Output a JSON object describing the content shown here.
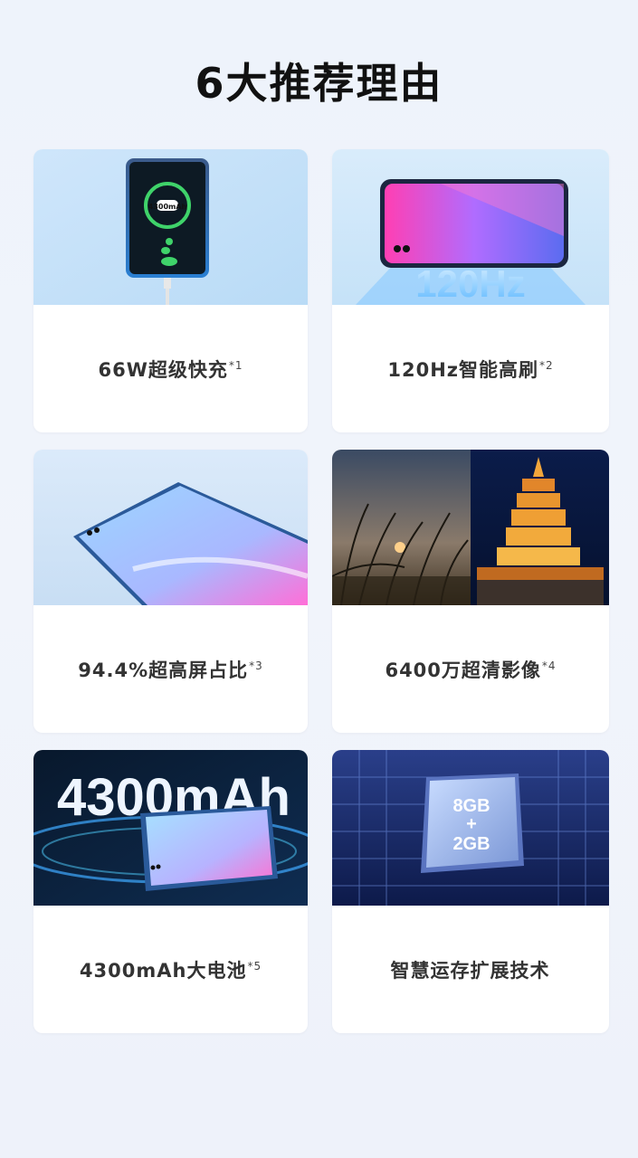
{
  "page_title": "6大推荐理由",
  "cards": [
    {
      "label": "66W超级快充",
      "note": "*1",
      "overlay": "100%"
    },
    {
      "label": "120Hz智能高刷",
      "note": "*2",
      "overlay": "120Hz"
    },
    {
      "label": "94.4%超高屏占比",
      "note": "*3"
    },
    {
      "label": "6400万超清影像",
      "note": "*4"
    },
    {
      "label": "4300mAh大电池",
      "note": "*5",
      "overlay": "4300mAh"
    },
    {
      "label": "智慧运存扩展技术",
      "note": "",
      "overlay_line1": "8GB",
      "overlay_line2": "+",
      "overlay_line3": "2GB"
    }
  ]
}
